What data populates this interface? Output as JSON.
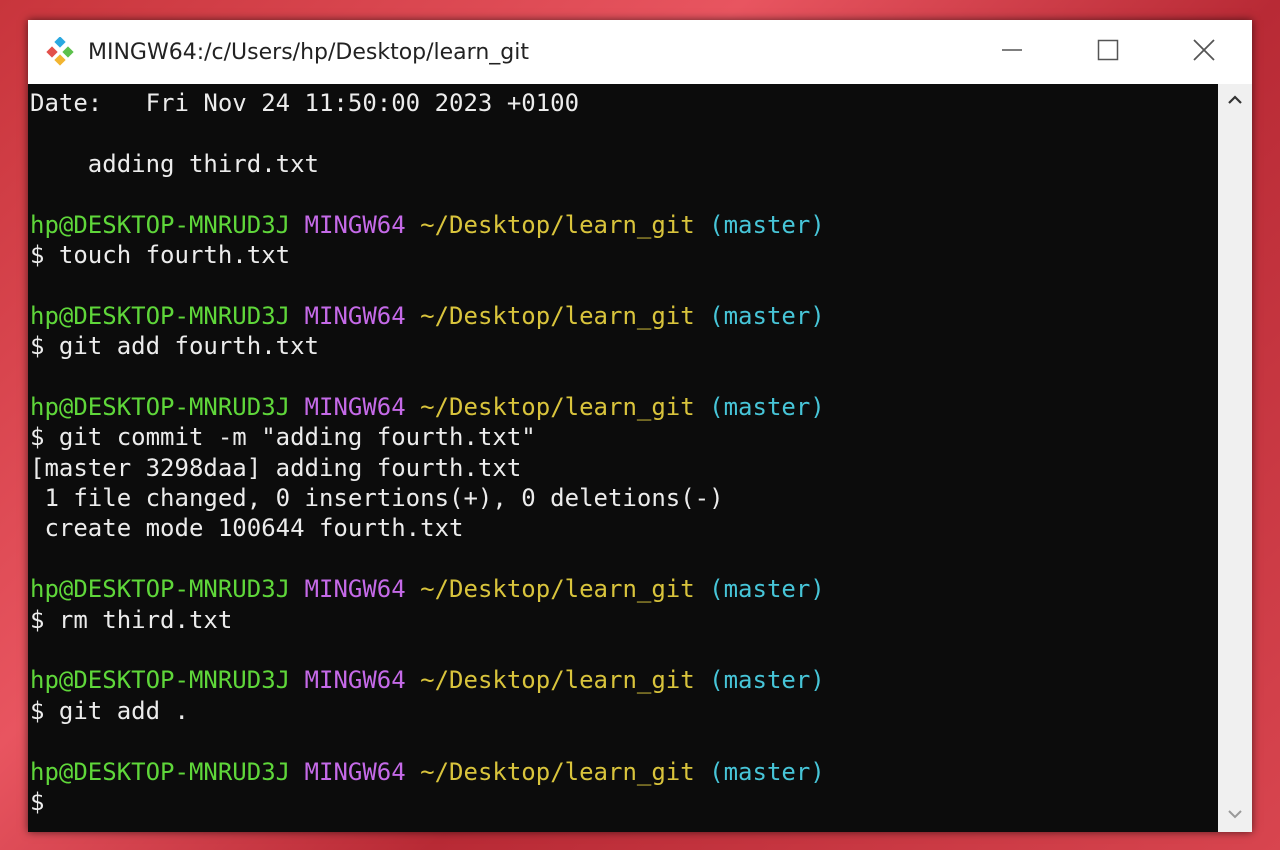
{
  "window": {
    "title": "MINGW64:/c/Users/hp/Desktop/learn_git",
    "icons": {
      "app": "git-bash-icon",
      "minimize": "minimize-icon",
      "maximize": "maximize-icon",
      "close": "close-icon"
    }
  },
  "prompt": {
    "user": "hp@DESKTOP-MNRUD3J",
    "shell": "MINGW64",
    "path": "~/Desktop/learn_git",
    "branch": "(master)"
  },
  "terminal": {
    "lines": [
      {
        "type": "text",
        "text": "Date:   Fri Nov 24 11:50:00 2023 +0100"
      },
      {
        "type": "blank"
      },
      {
        "type": "text",
        "text": "    adding third.txt"
      },
      {
        "type": "blank"
      },
      {
        "type": "prompt"
      },
      {
        "type": "text",
        "text": "$ touch fourth.txt"
      },
      {
        "type": "blank"
      },
      {
        "type": "prompt"
      },
      {
        "type": "text",
        "text": "$ git add fourth.txt"
      },
      {
        "type": "blank"
      },
      {
        "type": "prompt"
      },
      {
        "type": "text",
        "text": "$ git commit -m \"adding fourth.txt\""
      },
      {
        "type": "text",
        "text": "[master 3298daa] adding fourth.txt"
      },
      {
        "type": "text",
        "text": " 1 file changed, 0 insertions(+), 0 deletions(-)"
      },
      {
        "type": "text",
        "text": " create mode 100644 fourth.txt"
      },
      {
        "type": "blank"
      },
      {
        "type": "prompt"
      },
      {
        "type": "text",
        "text": "$ rm third.txt"
      },
      {
        "type": "blank"
      },
      {
        "type": "prompt"
      },
      {
        "type": "text",
        "text": "$ git add ."
      },
      {
        "type": "blank"
      },
      {
        "type": "prompt"
      },
      {
        "type": "text",
        "text": "$"
      }
    ]
  },
  "colors": {
    "user": "#5fd73a",
    "shell": "#c56ae8",
    "path": "#d9c43c",
    "branch": "#47c5d8",
    "background": "#0c0c0c"
  }
}
